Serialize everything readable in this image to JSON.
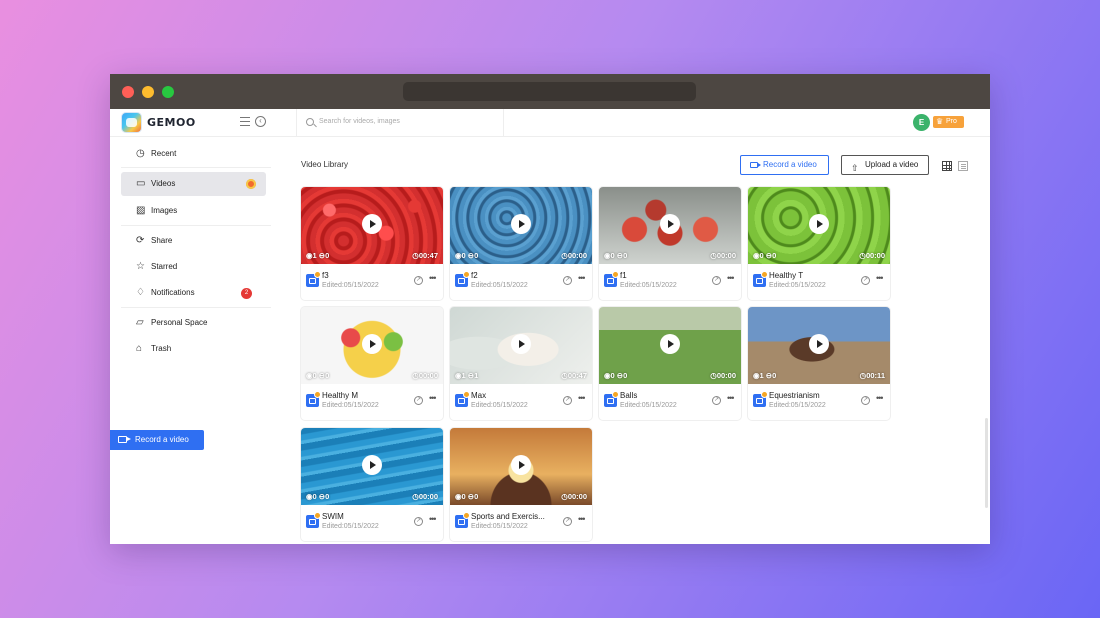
{
  "app": {
    "brand": "GEMOO",
    "avatar_letter": "E",
    "pro_label": "Pro",
    "search_placeholder": "Search for videos, images"
  },
  "sidebar": {
    "items": [
      {
        "label": "Recent",
        "icon": "clock-icon"
      },
      {
        "label": "Videos",
        "icon": "video-icon"
      },
      {
        "label": "Images",
        "icon": "image-icon"
      },
      {
        "label": "Share",
        "icon": "share-icon"
      },
      {
        "label": "Starred",
        "icon": "star-icon"
      },
      {
        "label": "Notifications",
        "icon": "bell-icon",
        "badge": "2"
      },
      {
        "label": "Personal Space",
        "icon": "folder-icon"
      },
      {
        "label": "Trash",
        "icon": "trash-icon"
      }
    ],
    "record_label": "Record a video"
  },
  "main": {
    "title": "Video Library",
    "record_label": "Record a video",
    "upload_label": "Upload a video"
  },
  "cards": [
    {
      "name": "f3",
      "date": "Edited:05/15/2022",
      "views": "1",
      "comments": "0",
      "duration": "00:47",
      "theme": "strawberries"
    },
    {
      "name": "f2",
      "date": "Edited:05/15/2022",
      "views": "0",
      "comments": "0",
      "duration": "00:00",
      "theme": "blueberries"
    },
    {
      "name": "f1",
      "date": "Edited:05/15/2022",
      "views": "0",
      "comments": "0",
      "duration": "00:00",
      "theme": "apples"
    },
    {
      "name": "Healthy T",
      "date": "Edited:05/15/2022",
      "views": "0",
      "comments": "0",
      "duration": "00:00",
      "theme": "green-apples"
    },
    {
      "name": "Healthy M",
      "date": "Edited:05/15/2022",
      "views": "0",
      "comments": "0",
      "duration": "00:00",
      "theme": "fruit"
    },
    {
      "name": "Max",
      "date": "Edited:05/15/2022",
      "views": "1",
      "comments": "1",
      "duration": "00:47",
      "theme": "cat"
    },
    {
      "name": "Balls",
      "date": "Edited:05/15/2022",
      "views": "0",
      "comments": "0",
      "duration": "00:00",
      "theme": "soccer"
    },
    {
      "name": "Equestrianism",
      "date": "Edited:05/15/2022",
      "views": "1",
      "comments": "0",
      "duration": "00:11",
      "theme": "horse"
    },
    {
      "name": "SWIM",
      "date": "Edited:05/15/2022",
      "views": "0",
      "comments": "0",
      "duration": "00:00",
      "theme": "swim"
    },
    {
      "name": "Sports and Exercis...",
      "date": "Edited:05/15/2022",
      "views": "0",
      "comments": "0",
      "duration": "00:00",
      "theme": "yoga"
    }
  ],
  "colors": {
    "accent": "#2f6ff2",
    "badge": "#e53935",
    "pro": "#f7a23b"
  }
}
